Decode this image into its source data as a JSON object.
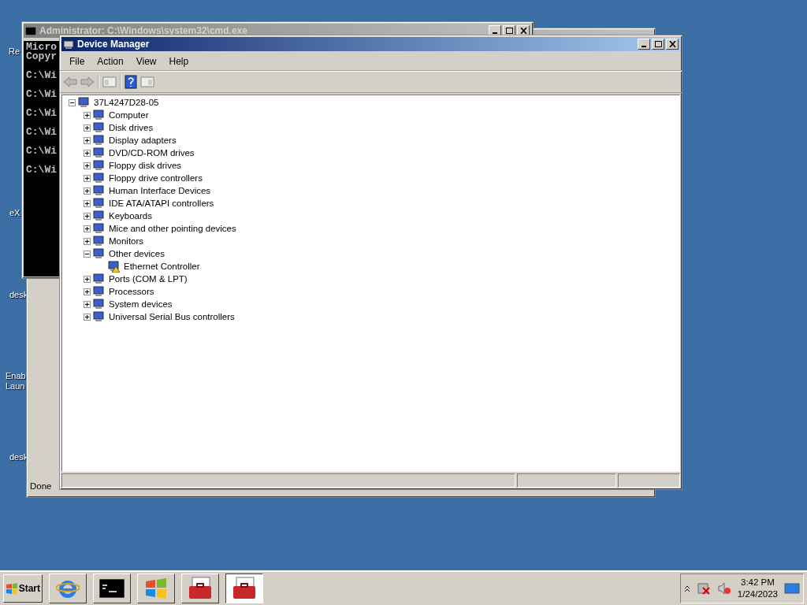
{
  "desktop_icons": [
    {
      "lines": [
        "Re"
      ]
    },
    {
      "lines": [
        "eX"
      ]
    },
    {
      "lines": [
        "desk"
      ]
    },
    {
      "lines": [
        "Enab",
        "Laun"
      ]
    },
    {
      "lines": [
        "desk"
      ]
    }
  ],
  "background_window": {
    "status": "Done"
  },
  "console_window": {
    "title": "Administrator: C:\\Windows\\system32\\cmd.exe",
    "lines": [
      "Micro",
      "Copyr",
      "C:\\Wi",
      "C:\\Wi",
      "C:\\Wi",
      "C:\\Wi",
      "C:\\Wi",
      "C:\\Wi"
    ]
  },
  "device_manager": {
    "title": "Device Manager",
    "menu": [
      "File",
      "Action",
      "View",
      "Help"
    ],
    "tree": {
      "label": "37L4247D28-05",
      "expanded": true,
      "children": [
        {
          "label": "Computer",
          "expanded": false
        },
        {
          "label": "Disk drives",
          "expanded": false
        },
        {
          "label": "Display adapters",
          "expanded": false
        },
        {
          "label": "DVD/CD-ROM drives",
          "expanded": false
        },
        {
          "label": "Floppy disk drives",
          "expanded": false
        },
        {
          "label": "Floppy drive controllers",
          "expanded": false
        },
        {
          "label": "Human Interface Devices",
          "expanded": false
        },
        {
          "label": "IDE ATA/ATAPI controllers",
          "expanded": false
        },
        {
          "label": "Keyboards",
          "expanded": false
        },
        {
          "label": "Mice and other pointing devices",
          "expanded": false
        },
        {
          "label": "Monitors",
          "expanded": false
        },
        {
          "label": "Other devices",
          "expanded": true,
          "children": [
            {
              "label": "Ethernet Controller",
              "warning": true
            }
          ]
        },
        {
          "label": "Ports (COM & LPT)",
          "expanded": false
        },
        {
          "label": "Processors",
          "expanded": false
        },
        {
          "label": "System devices",
          "expanded": false
        },
        {
          "label": "Universal Serial Bus controllers",
          "expanded": false
        }
      ]
    }
  },
  "taskbar": {
    "start": "Start",
    "buttons": [
      {
        "kind": "browser",
        "selected": false
      },
      {
        "kind": "console",
        "selected": false
      },
      {
        "kind": "windows",
        "selected": false
      },
      {
        "kind": "toolbox",
        "selected": false
      },
      {
        "kind": "toolbox",
        "selected": true
      }
    ],
    "tray": {
      "time": "3:42 PM",
      "date": "1/24/2023"
    }
  }
}
